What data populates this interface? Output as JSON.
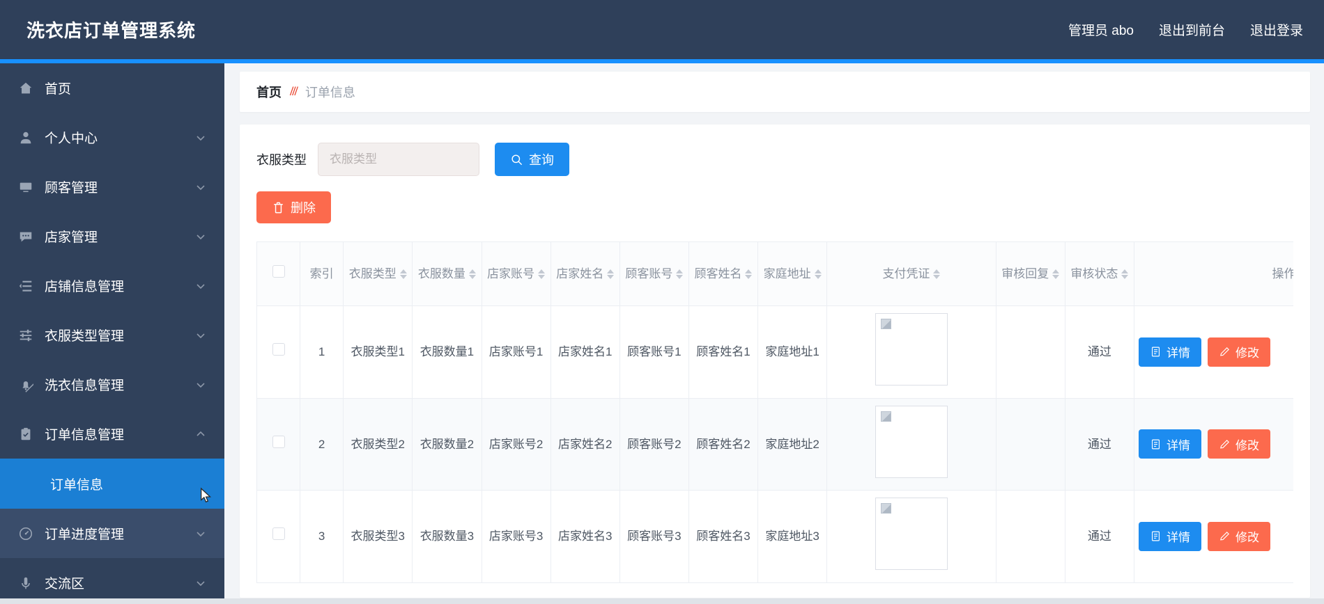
{
  "header": {
    "title": "洗衣店订单管理系统",
    "user_label": "管理员 abo",
    "exit_front_label": "退出到前台",
    "logout_label": "退出登录"
  },
  "sidebar": {
    "items": [
      {
        "label": "首页",
        "icon": "home-icon",
        "expandable": false
      },
      {
        "label": "个人中心",
        "icon": "user-icon",
        "expandable": true
      },
      {
        "label": "顾客管理",
        "icon": "monitor-icon",
        "expandable": true
      },
      {
        "label": "店家管理",
        "icon": "chat-icon",
        "expandable": true
      },
      {
        "label": "店铺信息管理",
        "icon": "list-icon",
        "expandable": true
      },
      {
        "label": "衣服类型管理",
        "icon": "sliders-icon",
        "expandable": true
      },
      {
        "label": "洗衣信息管理",
        "icon": "bell-off-icon",
        "expandable": true
      },
      {
        "label": "订单信息管理",
        "icon": "clipboard-check-icon",
        "expandable": true,
        "expanded": true
      },
      {
        "label": "订单进度管理",
        "icon": "gauge-icon",
        "expandable": true,
        "hovered": true
      },
      {
        "label": "交流区",
        "icon": "mic-icon",
        "expandable": true
      }
    ],
    "submenu_active": "订单信息"
  },
  "breadcrumb": {
    "home": "首页",
    "separator": "///",
    "current": "订单信息"
  },
  "filter": {
    "label": "衣服类型",
    "placeholder": "衣服类型",
    "value": "",
    "search_label": "查询",
    "search_icon": "search-icon"
  },
  "toolbar": {
    "delete_label": "删除",
    "delete_icon": "trash-icon"
  },
  "table": {
    "columns": [
      {
        "key": "checkbox",
        "label": "",
        "sortable": false
      },
      {
        "key": "index",
        "label": "索引",
        "sortable": false
      },
      {
        "key": "clothes_type",
        "label": "衣服类型",
        "sortable": true
      },
      {
        "key": "clothes_count",
        "label": "衣服数量",
        "sortable": true
      },
      {
        "key": "shop_account",
        "label": "店家账号",
        "sortable": true
      },
      {
        "key": "shop_name",
        "label": "店家姓名",
        "sortable": true
      },
      {
        "key": "customer_account",
        "label": "顾客账号",
        "sortable": true
      },
      {
        "key": "customer_name",
        "label": "顾客姓名",
        "sortable": true
      },
      {
        "key": "home_address",
        "label": "家庭地址",
        "sortable": true
      },
      {
        "key": "payment_voucher",
        "label": "支付凭证",
        "sortable": true
      },
      {
        "key": "audit_reply",
        "label": "审核回复",
        "sortable": true
      },
      {
        "key": "audit_status",
        "label": "审核状态",
        "sortable": true
      },
      {
        "key": "operations",
        "label": "操作",
        "sortable": false
      }
    ],
    "rows": [
      {
        "index": "1",
        "clothes_type": "衣服类型1",
        "clothes_count": "衣服数量1",
        "shop_account": "店家账号1",
        "shop_name": "店家姓名1",
        "customer_account": "顾客账号1",
        "customer_name": "顾客姓名1",
        "home_address": "家庭地址1",
        "payment_voucher": "payment-thumbnail",
        "audit_reply": "",
        "audit_status": "通过"
      },
      {
        "index": "2",
        "clothes_type": "衣服类型2",
        "clothes_count": "衣服数量2",
        "shop_account": "店家账号2",
        "shop_name": "店家姓名2",
        "customer_account": "顾客账号2",
        "customer_name": "顾客姓名2",
        "home_address": "家庭地址2",
        "payment_voucher": "payment-thumbnail",
        "audit_reply": "",
        "audit_status": "通过"
      },
      {
        "index": "3",
        "clothes_type": "衣服类型3",
        "clothes_count": "衣服数量3",
        "shop_account": "店家账号3",
        "shop_name": "店家姓名3",
        "customer_account": "顾客账号3",
        "customer_name": "顾客姓名3",
        "home_address": "家庭地址3",
        "payment_voucher": "payment-thumbnail",
        "audit_reply": "",
        "audit_status": "通过"
      }
    ],
    "row_actions": {
      "detail_label": "详情",
      "detail_icon": "document-icon",
      "edit_label": "修改",
      "edit_icon": "pencil-icon"
    }
  },
  "colors": {
    "header_bg": "#2f405a",
    "sidebar_bg": "#30415b",
    "accent_blue": "#1d8cf0",
    "active_blue": "#1b7fd4",
    "danger_red": "#fc6a4d",
    "breadcrumb_sep": "#e8402a"
  }
}
